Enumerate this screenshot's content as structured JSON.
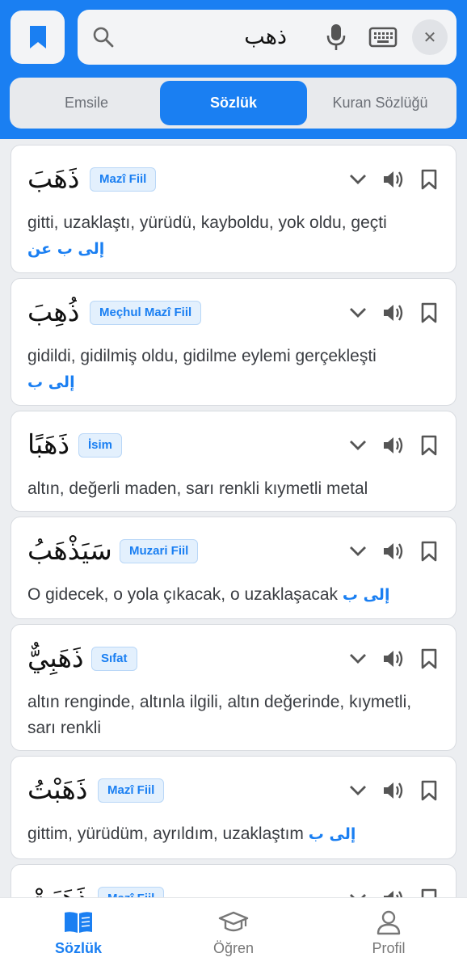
{
  "search": {
    "query": "ذهب",
    "clear_symbol": "✕"
  },
  "tabs": [
    {
      "label": "Emsile"
    },
    {
      "label": "Sözlük"
    },
    {
      "label": "Kuran Sözlüğü"
    }
  ],
  "results": [
    {
      "arabic": "ذَهَبَ",
      "badge": "Mazî Fiil",
      "meaning": "gitti, uzaklaştı, yürüdü, kayboldu, yok oldu, geçti",
      "prepositions": "إلى ب عن"
    },
    {
      "arabic": "ذُهِبَ",
      "badge": "Meçhul Mazî Fiil",
      "meaning": "gidildi, gidilmiş oldu, gidilme eylemi gerçekleşti",
      "prepositions": "إلى ب"
    },
    {
      "arabic": "ذَهَبًا",
      "badge": "İsim",
      "meaning": "altın, değerli maden, sarı renkli kıymetli metal",
      "prepositions": ""
    },
    {
      "arabic": "سَيَذْهَبُ",
      "badge": "Muzari Fiil",
      "meaning": "O gidecek, o yola çıkacak, o uzaklaşacak",
      "prepositions": "إلى ب"
    },
    {
      "arabic": "ذَهَبِيٌّ",
      "badge": "Sıfat",
      "meaning": "altın renginde, altınla ilgili, altın değerinde, kıymetli, sarı renkli",
      "prepositions": ""
    },
    {
      "arabic": "ذَهَبْتُ",
      "badge": "Mazî Fiil",
      "meaning": "gittim, yürüdüm, ayrıldım, uzaklaştım",
      "prepositions": "إلى ب"
    },
    {
      "arabic": "ذَهَبَتْ",
      "badge": "Mazî Fiil",
      "meaning": "",
      "prepositions": ""
    }
  ],
  "nav": [
    {
      "label": "Sözlük",
      "icon": "book-icon"
    },
    {
      "label": "Öğren",
      "icon": "graduation-cap-icon"
    },
    {
      "label": "Profil",
      "icon": "person-icon"
    }
  ],
  "colors": {
    "accent": "#1a7ff2",
    "badge_bg": "#e3f0fd",
    "page_bg": "#eceef1"
  }
}
